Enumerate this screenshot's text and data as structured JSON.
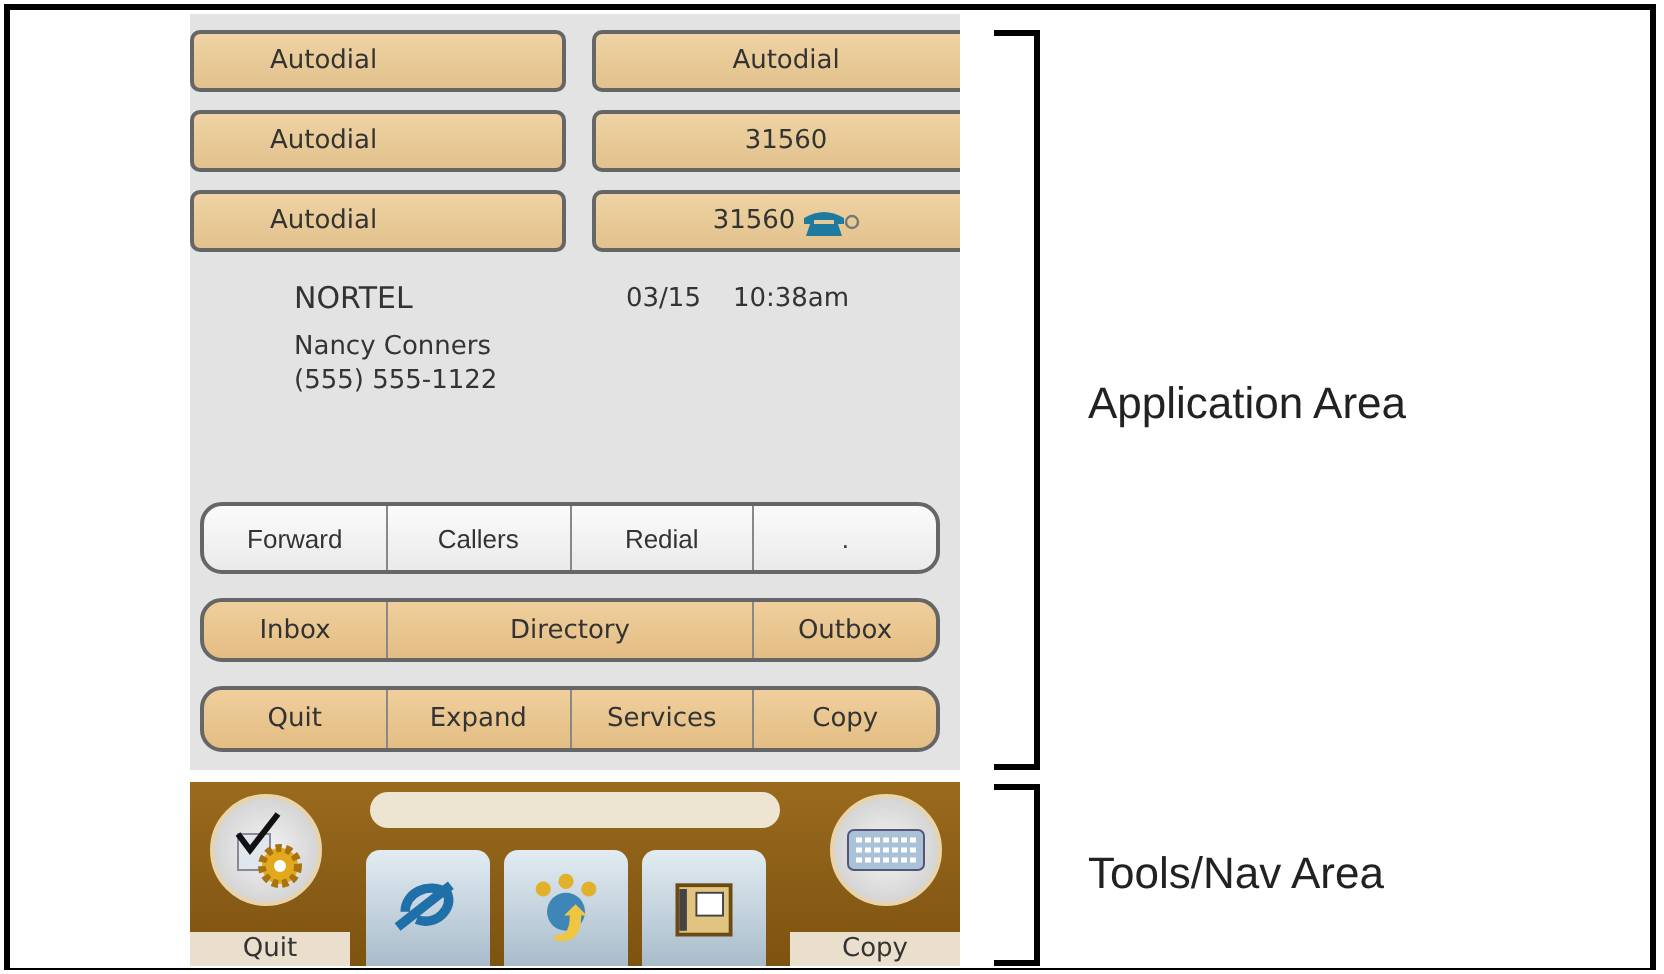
{
  "line_keys": [
    {
      "label": "Autodial",
      "kind": "plain"
    },
    {
      "label": "Autodial",
      "kind": "plain"
    },
    {
      "label": "Autodial",
      "kind": "plain"
    },
    {
      "label": "31560",
      "kind": "plain"
    },
    {
      "label": "Autodial",
      "kind": "plain"
    },
    {
      "label": "31560",
      "kind": "active"
    }
  ],
  "call_info": {
    "name": "NORTEL",
    "date": "03/15",
    "time": "10:38am",
    "caller_name": "Nancy Conners",
    "caller_number": "(555) 555-1122"
  },
  "softkey_rows": [
    {
      "kind": "plain",
      "keys": [
        {
          "label": "Forward"
        },
        {
          "label": "Callers"
        },
        {
          "label": "Redial"
        },
        {
          "label": "."
        }
      ]
    },
    {
      "kind": "tan",
      "keys": [
        {
          "label": "Inbox"
        },
        {
          "label": "Directory"
        },
        {
          "label": "Outbox"
        }
      ]
    },
    {
      "kind": "tan",
      "keys": [
        {
          "label": "Quit"
        },
        {
          "label": "Expand"
        },
        {
          "label": "Services"
        },
        {
          "label": "Copy"
        }
      ]
    }
  ],
  "tools": {
    "left_label": "Quit",
    "right_label": "Copy"
  },
  "annotations": [
    {
      "label": "Application Area"
    },
    {
      "label": "Tools/Nav Area"
    }
  ]
}
